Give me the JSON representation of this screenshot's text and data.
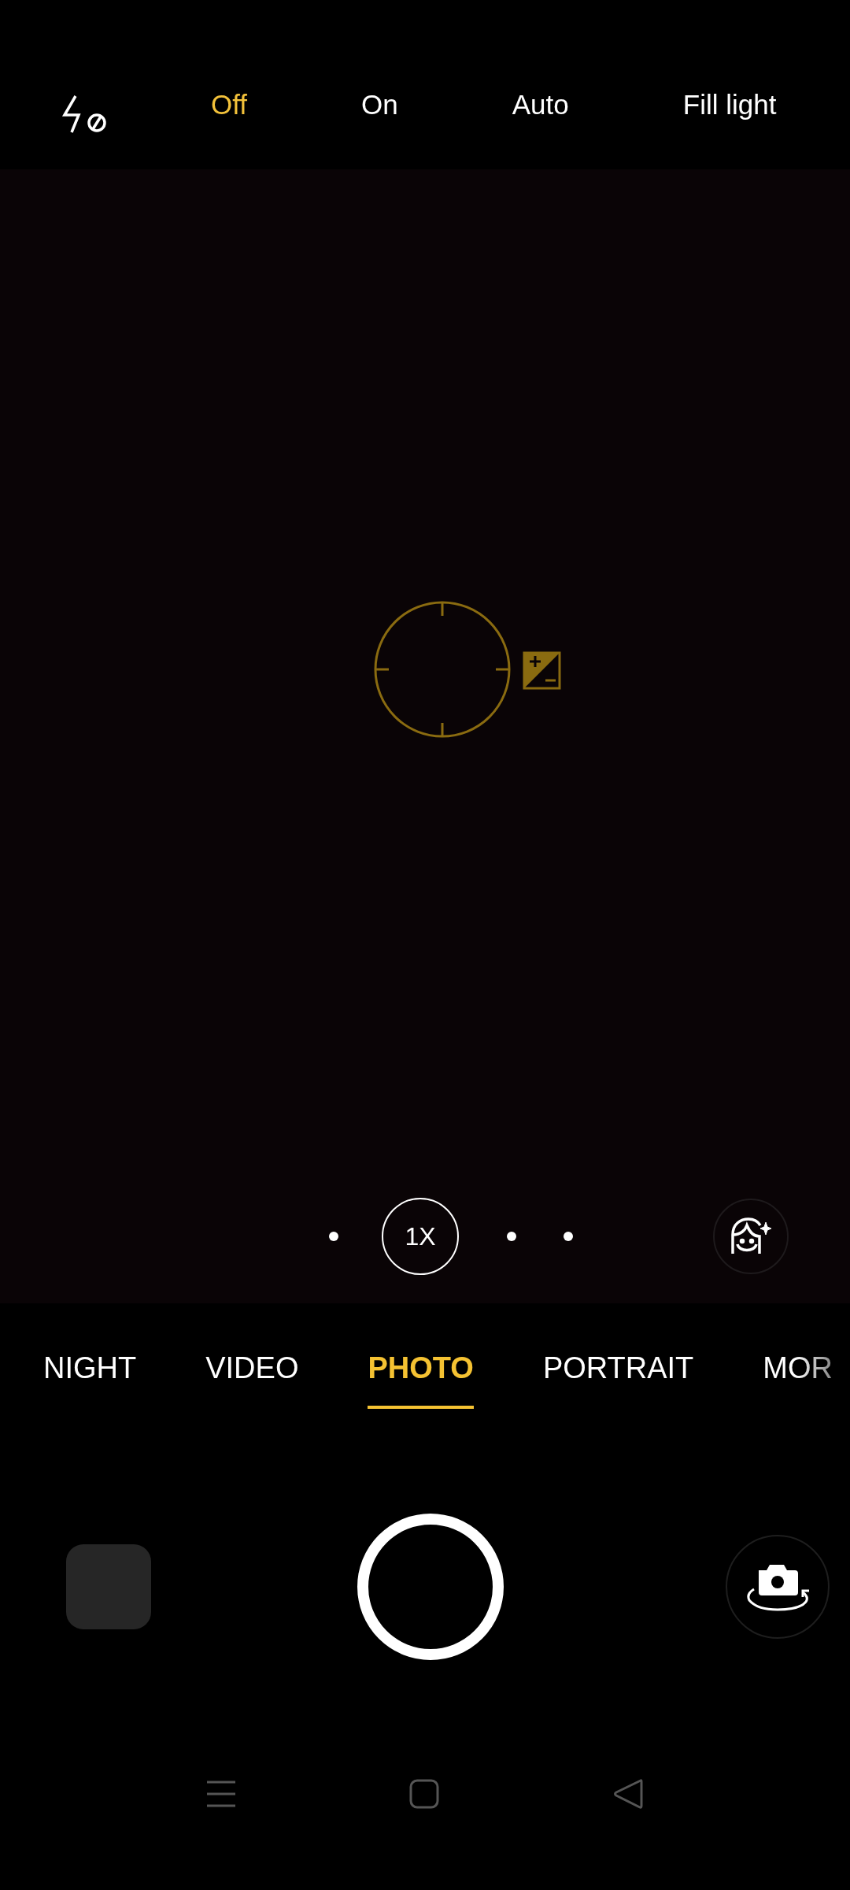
{
  "flash_bar": {
    "options": [
      {
        "label": "Off",
        "selected": true
      },
      {
        "label": "On",
        "selected": false
      },
      {
        "label": "Auto",
        "selected": false
      },
      {
        "label": "Fill light",
        "selected": false
      }
    ]
  },
  "zoom": {
    "label": "1X"
  },
  "modes": [
    {
      "label": "NIGHT",
      "selected": false
    },
    {
      "label": "VIDEO",
      "selected": false
    },
    {
      "label": "PHOTO",
      "selected": true
    },
    {
      "label": "PORTRAIT",
      "selected": false
    },
    {
      "label": "MOR",
      "selected": false
    }
  ]
}
